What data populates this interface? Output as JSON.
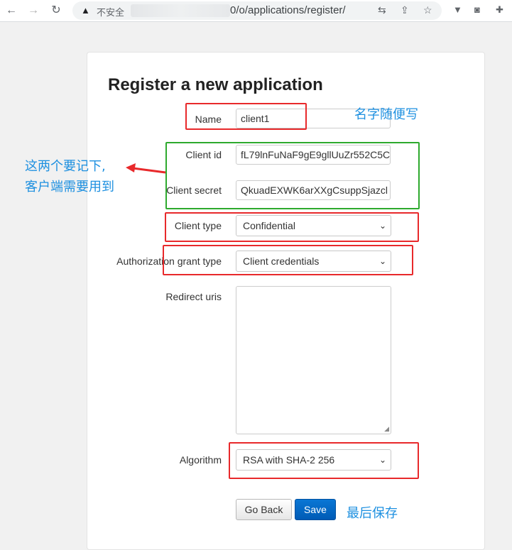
{
  "browser": {
    "back_icon": "←",
    "forward_icon": "→",
    "reload_icon": "↻",
    "warning_icon": "▲",
    "security_label": "不安全",
    "url_text": "0/o/applications/register/",
    "translate_icon": "⇆",
    "share_icon": "⇪",
    "star_icon": "☆",
    "ext1_icon": "▼",
    "ext2_icon": "◙",
    "puzzle_icon": "✚"
  },
  "form": {
    "title": "Register a new application",
    "name_label": "Name",
    "name_value": "client1",
    "client_id_label": "Client id",
    "client_id_value": "fL79lnFuNaF9gE9gllUuZr552C5C",
    "client_secret_label": "Client secret",
    "client_secret_value": "QkuadEXWK6arXXgCsuppSjazcl",
    "client_type_label": "Client type",
    "client_type_value": "Confidential",
    "grant_type_label": "Authorization grant type",
    "grant_type_value": "Client credentials",
    "redirect_label": "Redirect uris",
    "redirect_value": "",
    "algorithm_label": "Algorithm",
    "algorithm_value": "RSA with SHA-2 256",
    "chevron": "⌄",
    "resize_glyph": "◢",
    "go_back_label": "Go Back",
    "save_label": "Save"
  },
  "annotations": {
    "name_note": "名字随便写",
    "keys_note_line1": "这两个要记下,",
    "keys_note_line2": "客户端需要用到",
    "save_note": "最后保存",
    "colors": {
      "red": "#e8292b",
      "green": "#2eaa2e",
      "note_blue": "#1e90e0"
    }
  }
}
